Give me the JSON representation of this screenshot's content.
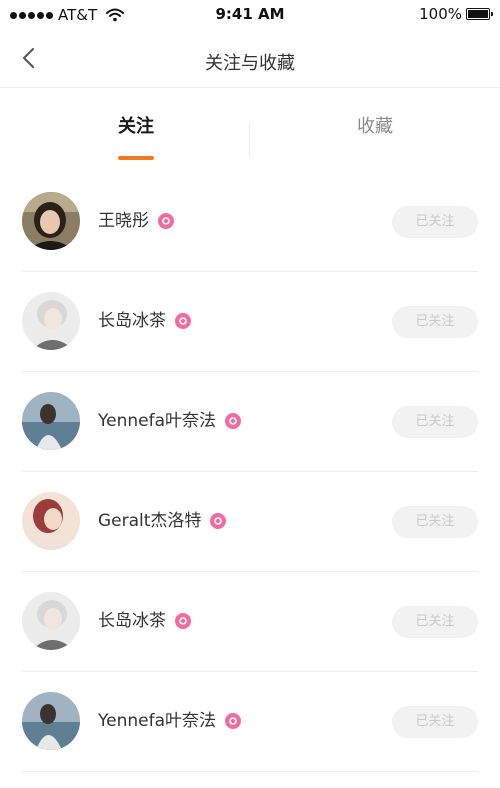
{
  "status_bar": {
    "carrier": "AT&T",
    "time": "9:41 AM",
    "battery": "100%",
    "icons": [
      "signal-dots-icon",
      "wifi-icon",
      "battery-icon"
    ]
  },
  "nav": {
    "back_icon": "chevron-left-icon",
    "title": "关注与收藏"
  },
  "tabs": [
    {
      "label": "关注",
      "active": true
    },
    {
      "label": "收藏",
      "active": false
    }
  ],
  "colors": {
    "accent": "#f07b21",
    "verified": "#f26aa0",
    "followed_button_bg": "#f2f2f2",
    "followed_button_text": "#c9c9c9"
  },
  "users": [
    {
      "name": "王晓彤",
      "verified": true,
      "button": "已关注"
    },
    {
      "name": "长岛冰茶",
      "verified": true,
      "button": "已关注"
    },
    {
      "name": "Yennefa叶奈法",
      "verified": true,
      "button": "已关注"
    },
    {
      "name": "Geralt杰洛特",
      "verified": true,
      "button": "已关注"
    },
    {
      "name": "长岛冰茶",
      "verified": true,
      "button": "已关注"
    },
    {
      "name": "Yennefa叶奈法",
      "verified": true,
      "button": "已关注"
    }
  ]
}
